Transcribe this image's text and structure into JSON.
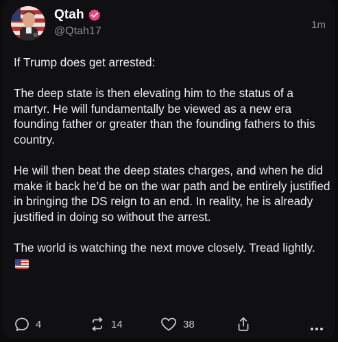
{
  "author": {
    "display_name": "Qtah",
    "handle": "@Qtah17",
    "verified": true,
    "avatar_icon": "profile-avatar-with-us-flag-background"
  },
  "post": {
    "timestamp": "1m",
    "paragraphs": [
      "If Trump does get arrested:",
      "The deep state is then elevating him to the status of a martyr. He will fundamentally be viewed as a new era founding father or greater than the founding fathers to this country.",
      "He will then beat the deep states charges, and when he did make it back he’d be on the war path and be entirely justified in bringing the DS reign to an end. In reality, he is already justified in doing so without the arrest.",
      "The world is watching the next move closely. Tread lightly."
    ],
    "trailing_emoji_icon": "us-flag-emoji-icon"
  },
  "actions": {
    "reply_count": "4",
    "repost_count": "14",
    "like_count": "38",
    "share_icon": "share-icon",
    "more_icon": "more-dots-icon"
  },
  "colors": {
    "background": "#101012",
    "text_primary": "#f0f0f0",
    "text_secondary": "#8d8d93",
    "verified_badge": "#f0447a"
  }
}
